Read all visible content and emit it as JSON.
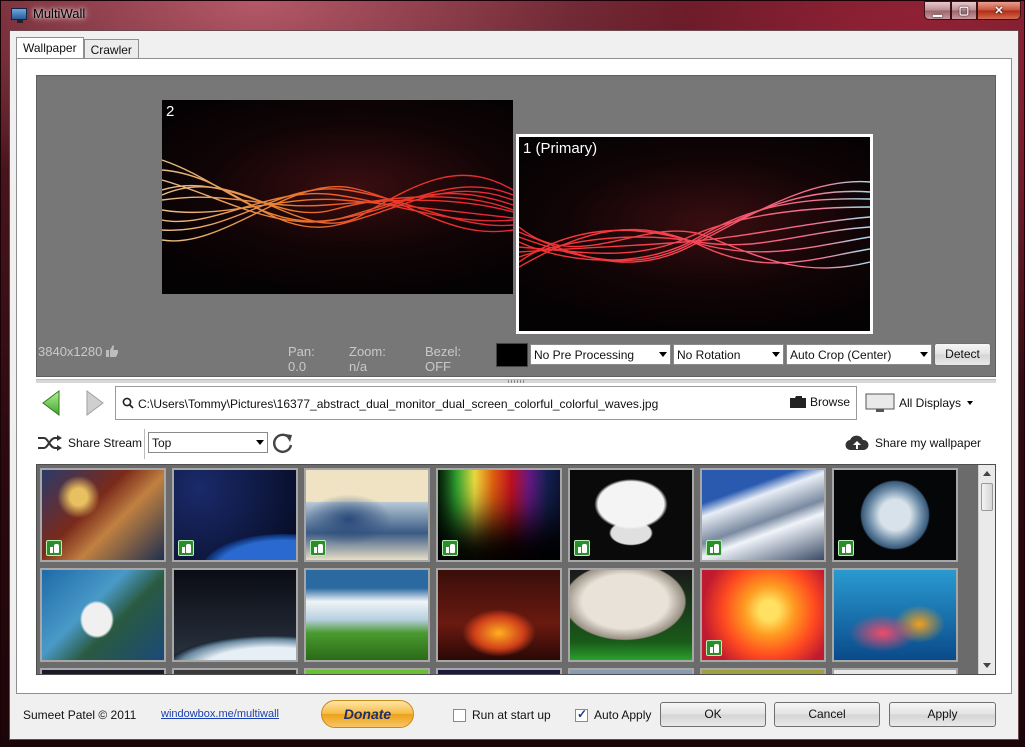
{
  "window": {
    "title": "MultiWall",
    "minimize_glyph": "▁",
    "maximize_glyph": "▢",
    "close_glyph": "✕"
  },
  "tabs": [
    {
      "label": "Wallpaper",
      "active": true
    },
    {
      "label": "Crawler",
      "active": false
    }
  ],
  "preview": {
    "monitor2_label": "2",
    "monitor1_label": "1 (Primary)",
    "resolution": "3840x1280",
    "pan": "Pan: 0.0",
    "zoom": "Zoom: n/a",
    "bezel": "Bezel: OFF",
    "bezel_color": "#000000",
    "pre_processing": "No Pre Processing",
    "rotation": "No Rotation",
    "crop": "Auto Crop (Center)",
    "detect_label": "Detect"
  },
  "path_bar": {
    "path": "C:\\Users\\Tommy\\Pictures\\16377_abstract_dual_monitor_dual_screen_colorful_colorful_waves.jpg",
    "browse_label": "Browse",
    "displays_label": "All Displays"
  },
  "stream_bar": {
    "share_stream_label": "Share Stream",
    "sort_value": "Top",
    "share_wallpaper_label": "Share my wallpaper"
  },
  "gallery": {
    "tiles": [
      {
        "subject": "heroes collage",
        "liked": true
      },
      {
        "subject": "earth from orbit blue",
        "liked": true
      },
      {
        "subject": "great wave",
        "liked": true
      },
      {
        "subject": "rainbow streaks",
        "liked": true
      },
      {
        "subject": "pirate skull",
        "liked": true
      },
      {
        "subject": "snowy mountains",
        "liked": true
      },
      {
        "subject": "earth globe",
        "liked": true
      },
      {
        "subject": "space shuttle over earth",
        "liked": false
      },
      {
        "subject": "earth horizon",
        "liked": false
      },
      {
        "subject": "green hills sky",
        "liked": false
      },
      {
        "subject": "fire demon",
        "liked": false
      },
      {
        "subject": "baseball",
        "liked": false
      },
      {
        "subject": "sunset tree silhouette",
        "liked": true
      },
      {
        "subject": "coral reef",
        "liked": false
      }
    ]
  },
  "footer": {
    "author": "Sumeet Patel © 2011",
    "link": "windowbox.me/multiwall",
    "donate_label": "Donate",
    "run_at_startup_label": "Run at start up",
    "run_at_startup_checked": false,
    "auto_apply_label": "Auto Apply",
    "auto_apply_checked": true,
    "ok_label": "OK",
    "cancel_label": "Cancel",
    "apply_label": "Apply"
  }
}
